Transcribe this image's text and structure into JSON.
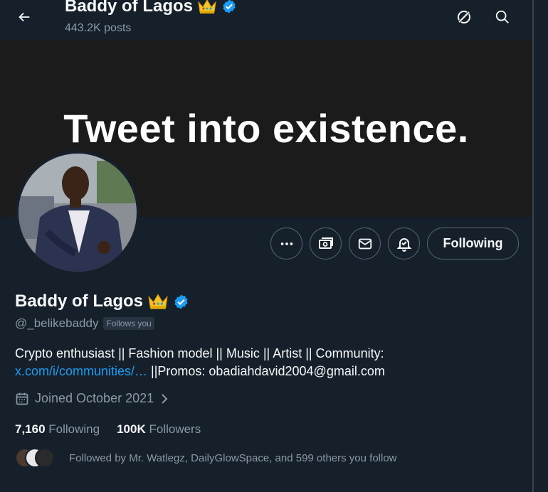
{
  "header": {
    "title": "Baddy of Lagos",
    "posts_count": "443.2K posts"
  },
  "banner": {
    "text": "Tweet into existence."
  },
  "actions": {
    "following_label": "Following"
  },
  "profile": {
    "name": "Baddy of Lagos",
    "handle": "@_belikebaddy",
    "follows_you": "Follows you",
    "bio_text_1": "Crypto enthusiast || Fashion model || Music || Artist || Community:",
    "bio_link": "x.com/i/communities/…",
    "bio_text_2": " ||Promos: obadiahdavid2004@gmail.com",
    "joined": "Joined October 2021",
    "following_count": "7,160",
    "following_label": "Following",
    "followers_count": "100K",
    "followers_label": "Followers",
    "followed_by": "Followed by Mr. Watlegz, DailyGlowSpace, and 599 others you follow"
  },
  "icons": [
    "back-arrow-icon",
    "grok-icon",
    "search-icon",
    "more-icon",
    "monetization-icon",
    "message-icon",
    "notification-bell-icon",
    "verified-badge-icon",
    "crown-emoji-icon",
    "calendar-icon",
    "chevron-right-icon"
  ],
  "colors": {
    "background": "#15202b",
    "accent": "#1d9bf0",
    "muted": "#8b98a5",
    "border": "#536471"
  }
}
